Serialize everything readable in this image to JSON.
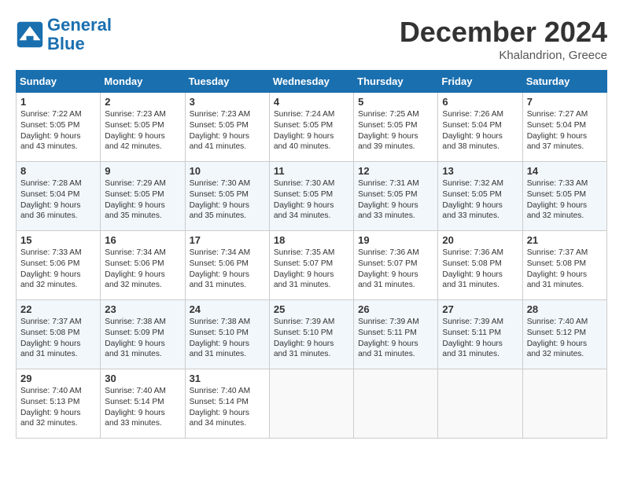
{
  "header": {
    "logo_line1": "General",
    "logo_line2": "Blue",
    "month": "December 2024",
    "location": "Khalandrion, Greece"
  },
  "weekdays": [
    "Sunday",
    "Monday",
    "Tuesday",
    "Wednesday",
    "Thursday",
    "Friday",
    "Saturday"
  ],
  "weeks": [
    [
      {
        "day": "1",
        "lines": [
          "Sunrise: 7:22 AM",
          "Sunset: 5:05 PM",
          "Daylight: 9 hours",
          "and 43 minutes."
        ]
      },
      {
        "day": "2",
        "lines": [
          "Sunrise: 7:23 AM",
          "Sunset: 5:05 PM",
          "Daylight: 9 hours",
          "and 42 minutes."
        ]
      },
      {
        "day": "3",
        "lines": [
          "Sunrise: 7:23 AM",
          "Sunset: 5:05 PM",
          "Daylight: 9 hours",
          "and 41 minutes."
        ]
      },
      {
        "day": "4",
        "lines": [
          "Sunrise: 7:24 AM",
          "Sunset: 5:05 PM",
          "Daylight: 9 hours",
          "and 40 minutes."
        ]
      },
      {
        "day": "5",
        "lines": [
          "Sunrise: 7:25 AM",
          "Sunset: 5:05 PM",
          "Daylight: 9 hours",
          "and 39 minutes."
        ]
      },
      {
        "day": "6",
        "lines": [
          "Sunrise: 7:26 AM",
          "Sunset: 5:04 PM",
          "Daylight: 9 hours",
          "and 38 minutes."
        ]
      },
      {
        "day": "7",
        "lines": [
          "Sunrise: 7:27 AM",
          "Sunset: 5:04 PM",
          "Daylight: 9 hours",
          "and 37 minutes."
        ]
      }
    ],
    [
      {
        "day": "8",
        "lines": [
          "Sunrise: 7:28 AM",
          "Sunset: 5:04 PM",
          "Daylight: 9 hours",
          "and 36 minutes."
        ]
      },
      {
        "day": "9",
        "lines": [
          "Sunrise: 7:29 AM",
          "Sunset: 5:05 PM",
          "Daylight: 9 hours",
          "and 35 minutes."
        ]
      },
      {
        "day": "10",
        "lines": [
          "Sunrise: 7:30 AM",
          "Sunset: 5:05 PM",
          "Daylight: 9 hours",
          "and 35 minutes."
        ]
      },
      {
        "day": "11",
        "lines": [
          "Sunrise: 7:30 AM",
          "Sunset: 5:05 PM",
          "Daylight: 9 hours",
          "and 34 minutes."
        ]
      },
      {
        "day": "12",
        "lines": [
          "Sunrise: 7:31 AM",
          "Sunset: 5:05 PM",
          "Daylight: 9 hours",
          "and 33 minutes."
        ]
      },
      {
        "day": "13",
        "lines": [
          "Sunrise: 7:32 AM",
          "Sunset: 5:05 PM",
          "Daylight: 9 hours",
          "and 33 minutes."
        ]
      },
      {
        "day": "14",
        "lines": [
          "Sunrise: 7:33 AM",
          "Sunset: 5:05 PM",
          "Daylight: 9 hours",
          "and 32 minutes."
        ]
      }
    ],
    [
      {
        "day": "15",
        "lines": [
          "Sunrise: 7:33 AM",
          "Sunset: 5:06 PM",
          "Daylight: 9 hours",
          "and 32 minutes."
        ]
      },
      {
        "day": "16",
        "lines": [
          "Sunrise: 7:34 AM",
          "Sunset: 5:06 PM",
          "Daylight: 9 hours",
          "and 32 minutes."
        ]
      },
      {
        "day": "17",
        "lines": [
          "Sunrise: 7:34 AM",
          "Sunset: 5:06 PM",
          "Daylight: 9 hours",
          "and 31 minutes."
        ]
      },
      {
        "day": "18",
        "lines": [
          "Sunrise: 7:35 AM",
          "Sunset: 5:07 PM",
          "Daylight: 9 hours",
          "and 31 minutes."
        ]
      },
      {
        "day": "19",
        "lines": [
          "Sunrise: 7:36 AM",
          "Sunset: 5:07 PM",
          "Daylight: 9 hours",
          "and 31 minutes."
        ]
      },
      {
        "day": "20",
        "lines": [
          "Sunrise: 7:36 AM",
          "Sunset: 5:08 PM",
          "Daylight: 9 hours",
          "and 31 minutes."
        ]
      },
      {
        "day": "21",
        "lines": [
          "Sunrise: 7:37 AM",
          "Sunset: 5:08 PM",
          "Daylight: 9 hours",
          "and 31 minutes."
        ]
      }
    ],
    [
      {
        "day": "22",
        "lines": [
          "Sunrise: 7:37 AM",
          "Sunset: 5:08 PM",
          "Daylight: 9 hours",
          "and 31 minutes."
        ]
      },
      {
        "day": "23",
        "lines": [
          "Sunrise: 7:38 AM",
          "Sunset: 5:09 PM",
          "Daylight: 9 hours",
          "and 31 minutes."
        ]
      },
      {
        "day": "24",
        "lines": [
          "Sunrise: 7:38 AM",
          "Sunset: 5:10 PM",
          "Daylight: 9 hours",
          "and 31 minutes."
        ]
      },
      {
        "day": "25",
        "lines": [
          "Sunrise: 7:39 AM",
          "Sunset: 5:10 PM",
          "Daylight: 9 hours",
          "and 31 minutes."
        ]
      },
      {
        "day": "26",
        "lines": [
          "Sunrise: 7:39 AM",
          "Sunset: 5:11 PM",
          "Daylight: 9 hours",
          "and 31 minutes."
        ]
      },
      {
        "day": "27",
        "lines": [
          "Sunrise: 7:39 AM",
          "Sunset: 5:11 PM",
          "Daylight: 9 hours",
          "and 31 minutes."
        ]
      },
      {
        "day": "28",
        "lines": [
          "Sunrise: 7:40 AM",
          "Sunset: 5:12 PM",
          "Daylight: 9 hours",
          "and 32 minutes."
        ]
      }
    ],
    [
      {
        "day": "29",
        "lines": [
          "Sunrise: 7:40 AM",
          "Sunset: 5:13 PM",
          "Daylight: 9 hours",
          "and 32 minutes."
        ]
      },
      {
        "day": "30",
        "lines": [
          "Sunrise: 7:40 AM",
          "Sunset: 5:14 PM",
          "Daylight: 9 hours",
          "and 33 minutes."
        ]
      },
      {
        "day": "31",
        "lines": [
          "Sunrise: 7:40 AM",
          "Sunset: 5:14 PM",
          "Daylight: 9 hours",
          "and 34 minutes."
        ]
      },
      null,
      null,
      null,
      null
    ]
  ]
}
